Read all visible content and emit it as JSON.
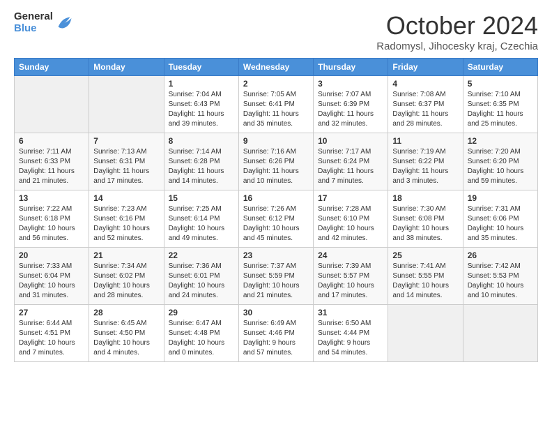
{
  "header": {
    "logo_general": "General",
    "logo_blue": "Blue",
    "title": "October 2024",
    "subtitle": "Radomysl, Jihocesky kraj, Czechia"
  },
  "days_of_week": [
    "Sunday",
    "Monday",
    "Tuesday",
    "Wednesday",
    "Thursday",
    "Friday",
    "Saturday"
  ],
  "weeks": [
    [
      {
        "day": "",
        "info": ""
      },
      {
        "day": "",
        "info": ""
      },
      {
        "day": "1",
        "info": "Sunrise: 7:04 AM\nSunset: 6:43 PM\nDaylight: 11 hours and 39 minutes."
      },
      {
        "day": "2",
        "info": "Sunrise: 7:05 AM\nSunset: 6:41 PM\nDaylight: 11 hours and 35 minutes."
      },
      {
        "day": "3",
        "info": "Sunrise: 7:07 AM\nSunset: 6:39 PM\nDaylight: 11 hours and 32 minutes."
      },
      {
        "day": "4",
        "info": "Sunrise: 7:08 AM\nSunset: 6:37 PM\nDaylight: 11 hours and 28 minutes."
      },
      {
        "day": "5",
        "info": "Sunrise: 7:10 AM\nSunset: 6:35 PM\nDaylight: 11 hours and 25 minutes."
      }
    ],
    [
      {
        "day": "6",
        "info": "Sunrise: 7:11 AM\nSunset: 6:33 PM\nDaylight: 11 hours and 21 minutes."
      },
      {
        "day": "7",
        "info": "Sunrise: 7:13 AM\nSunset: 6:31 PM\nDaylight: 11 hours and 17 minutes."
      },
      {
        "day": "8",
        "info": "Sunrise: 7:14 AM\nSunset: 6:28 PM\nDaylight: 11 hours and 14 minutes."
      },
      {
        "day": "9",
        "info": "Sunrise: 7:16 AM\nSunset: 6:26 PM\nDaylight: 11 hours and 10 minutes."
      },
      {
        "day": "10",
        "info": "Sunrise: 7:17 AM\nSunset: 6:24 PM\nDaylight: 11 hours and 7 minutes."
      },
      {
        "day": "11",
        "info": "Sunrise: 7:19 AM\nSunset: 6:22 PM\nDaylight: 11 hours and 3 minutes."
      },
      {
        "day": "12",
        "info": "Sunrise: 7:20 AM\nSunset: 6:20 PM\nDaylight: 10 hours and 59 minutes."
      }
    ],
    [
      {
        "day": "13",
        "info": "Sunrise: 7:22 AM\nSunset: 6:18 PM\nDaylight: 10 hours and 56 minutes."
      },
      {
        "day": "14",
        "info": "Sunrise: 7:23 AM\nSunset: 6:16 PM\nDaylight: 10 hours and 52 minutes."
      },
      {
        "day": "15",
        "info": "Sunrise: 7:25 AM\nSunset: 6:14 PM\nDaylight: 10 hours and 49 minutes."
      },
      {
        "day": "16",
        "info": "Sunrise: 7:26 AM\nSunset: 6:12 PM\nDaylight: 10 hours and 45 minutes."
      },
      {
        "day": "17",
        "info": "Sunrise: 7:28 AM\nSunset: 6:10 PM\nDaylight: 10 hours and 42 minutes."
      },
      {
        "day": "18",
        "info": "Sunrise: 7:30 AM\nSunset: 6:08 PM\nDaylight: 10 hours and 38 minutes."
      },
      {
        "day": "19",
        "info": "Sunrise: 7:31 AM\nSunset: 6:06 PM\nDaylight: 10 hours and 35 minutes."
      }
    ],
    [
      {
        "day": "20",
        "info": "Sunrise: 7:33 AM\nSunset: 6:04 PM\nDaylight: 10 hours and 31 minutes."
      },
      {
        "day": "21",
        "info": "Sunrise: 7:34 AM\nSunset: 6:02 PM\nDaylight: 10 hours and 28 minutes."
      },
      {
        "day": "22",
        "info": "Sunrise: 7:36 AM\nSunset: 6:01 PM\nDaylight: 10 hours and 24 minutes."
      },
      {
        "day": "23",
        "info": "Sunrise: 7:37 AM\nSunset: 5:59 PM\nDaylight: 10 hours and 21 minutes."
      },
      {
        "day": "24",
        "info": "Sunrise: 7:39 AM\nSunset: 5:57 PM\nDaylight: 10 hours and 17 minutes."
      },
      {
        "day": "25",
        "info": "Sunrise: 7:41 AM\nSunset: 5:55 PM\nDaylight: 10 hours and 14 minutes."
      },
      {
        "day": "26",
        "info": "Sunrise: 7:42 AM\nSunset: 5:53 PM\nDaylight: 10 hours and 10 minutes."
      }
    ],
    [
      {
        "day": "27",
        "info": "Sunrise: 6:44 AM\nSunset: 4:51 PM\nDaylight: 10 hours and 7 minutes."
      },
      {
        "day": "28",
        "info": "Sunrise: 6:45 AM\nSunset: 4:50 PM\nDaylight: 10 hours and 4 minutes."
      },
      {
        "day": "29",
        "info": "Sunrise: 6:47 AM\nSunset: 4:48 PM\nDaylight: 10 hours and 0 minutes."
      },
      {
        "day": "30",
        "info": "Sunrise: 6:49 AM\nSunset: 4:46 PM\nDaylight: 9 hours and 57 minutes."
      },
      {
        "day": "31",
        "info": "Sunrise: 6:50 AM\nSunset: 4:44 PM\nDaylight: 9 hours and 54 minutes."
      },
      {
        "day": "",
        "info": ""
      },
      {
        "day": "",
        "info": ""
      }
    ]
  ]
}
